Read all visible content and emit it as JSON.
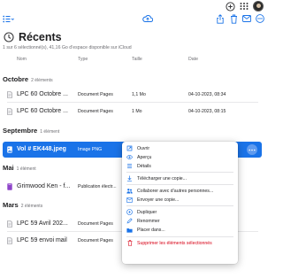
{
  "colors": {
    "accent": "#1a73e8",
    "danger": "#d70015",
    "text": "#1d1d1f",
    "muted": "#6e6e73"
  },
  "header": {
    "title": "Récents",
    "subtitle": "1 sur 6 sélectionné(s), 41,16 Go d’espace disponible sur iCloud",
    "top_icons": [
      "add-icon",
      "app-grid-icon",
      "account-avatar"
    ],
    "toolbar_icons": [
      "list-view-icon",
      "cloud-upload-icon",
      "share-icon",
      "trash-icon",
      "mail-icon",
      "more-icon"
    ]
  },
  "columns": {
    "name": "Nom",
    "type": "Type",
    "size": "Taille",
    "date": "Date"
  },
  "groups": [
    {
      "name": "Octobre",
      "count": "2 éléments"
    },
    {
      "name": "Septembre",
      "count": "1 élément"
    },
    {
      "name": "Mai",
      "count": "1 élément"
    },
    {
      "name": "Mars",
      "count": "2 éléments"
    }
  ],
  "files": [
    {
      "name": "LPC 60 Octobre ...",
      "type": "Document Pages",
      "size": "1,1 Mo",
      "date": "04-10-2023, 08:34",
      "icon": "document-icon"
    },
    {
      "name": "LPC 60 Octobre ...",
      "type": "Document Pages",
      "size": "1 Mo",
      "date": "04-10-2023, 08:15",
      "icon": "document-icon"
    },
    {
      "name": "Vol # EK448.jpeg",
      "type": "Image PNG",
      "size": "",
      "date": "",
      "icon": "image-icon",
      "selected": true
    },
    {
      "name": "Grimwood Ken - f...",
      "type": "Publication électr...",
      "size": "",
      "date": "",
      "icon": "book-icon"
    },
    {
      "name": "LPC 59 Avril 202...",
      "type": "Document Pages",
      "size": "",
      "date": "",
      "icon": "document-icon"
    },
    {
      "name": "LPC 59 envoi mail",
      "type": "Document Pages",
      "size": "",
      "date": "",
      "icon": "document-icon"
    }
  ],
  "context_menu": {
    "items": [
      {
        "label": "Ouvrir",
        "icon": "open-icon"
      },
      {
        "label": "Aperçu",
        "icon": "eye-icon"
      },
      {
        "label": "Détails",
        "icon": "info-icon"
      },
      {
        "label": "Télécharger une copie...",
        "icon": "download-icon"
      },
      {
        "label": "Collaborer avec d’autres personnes...",
        "icon": "collaborate-icon"
      },
      {
        "label": "Envoyer une copie...",
        "icon": "send-icon"
      },
      {
        "label": "Dupliquer",
        "icon": "duplicate-icon"
      },
      {
        "label": "Renommer",
        "icon": "rename-icon"
      },
      {
        "label": "Placer dans...",
        "icon": "move-icon"
      },
      {
        "label": "Supprimer les éléments sélectionnés",
        "icon": "trash-icon"
      }
    ]
  }
}
